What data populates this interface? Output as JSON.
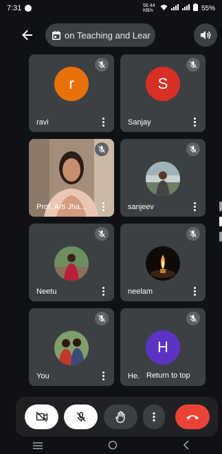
{
  "status_bar": {
    "time": "7:31",
    "net_speed": "56.44 KB/s",
    "battery": "55%"
  },
  "meeting": {
    "title": "on Teaching and Lear"
  },
  "participants": [
    {
      "name": "ravi",
      "avatar_letter": "r",
      "avatar_color": "#e8710a",
      "muted": true
    },
    {
      "name": "Sanjay",
      "avatar_letter": "S",
      "avatar_color": "#d93025",
      "muted": true
    },
    {
      "name": "Prof. Arti Jha...",
      "video": true,
      "muted": true
    },
    {
      "name": "sanjeev",
      "photo": "outdoor-portrait",
      "muted": true
    },
    {
      "name": "Neetu",
      "photo": "red-dress-portrait",
      "muted": true
    },
    {
      "name": "neelam",
      "photo": "candle-flame",
      "muted": true
    },
    {
      "name": "You",
      "photo": "couple-portrait",
      "muted": true
    },
    {
      "name": "He...",
      "avatar_letter": "H",
      "avatar_color": "#5b34c4",
      "muted": true
    }
  ],
  "tooltip": "Return to top",
  "controls": {
    "camera_off_icon": "video-off-icon",
    "mic_off_icon": "mic-off-icon",
    "raise_hand_icon": "hand-icon",
    "more_icon": "more-vert-icon",
    "end_call_icon": "call-end-icon",
    "end_call_color": "#ea4335"
  }
}
